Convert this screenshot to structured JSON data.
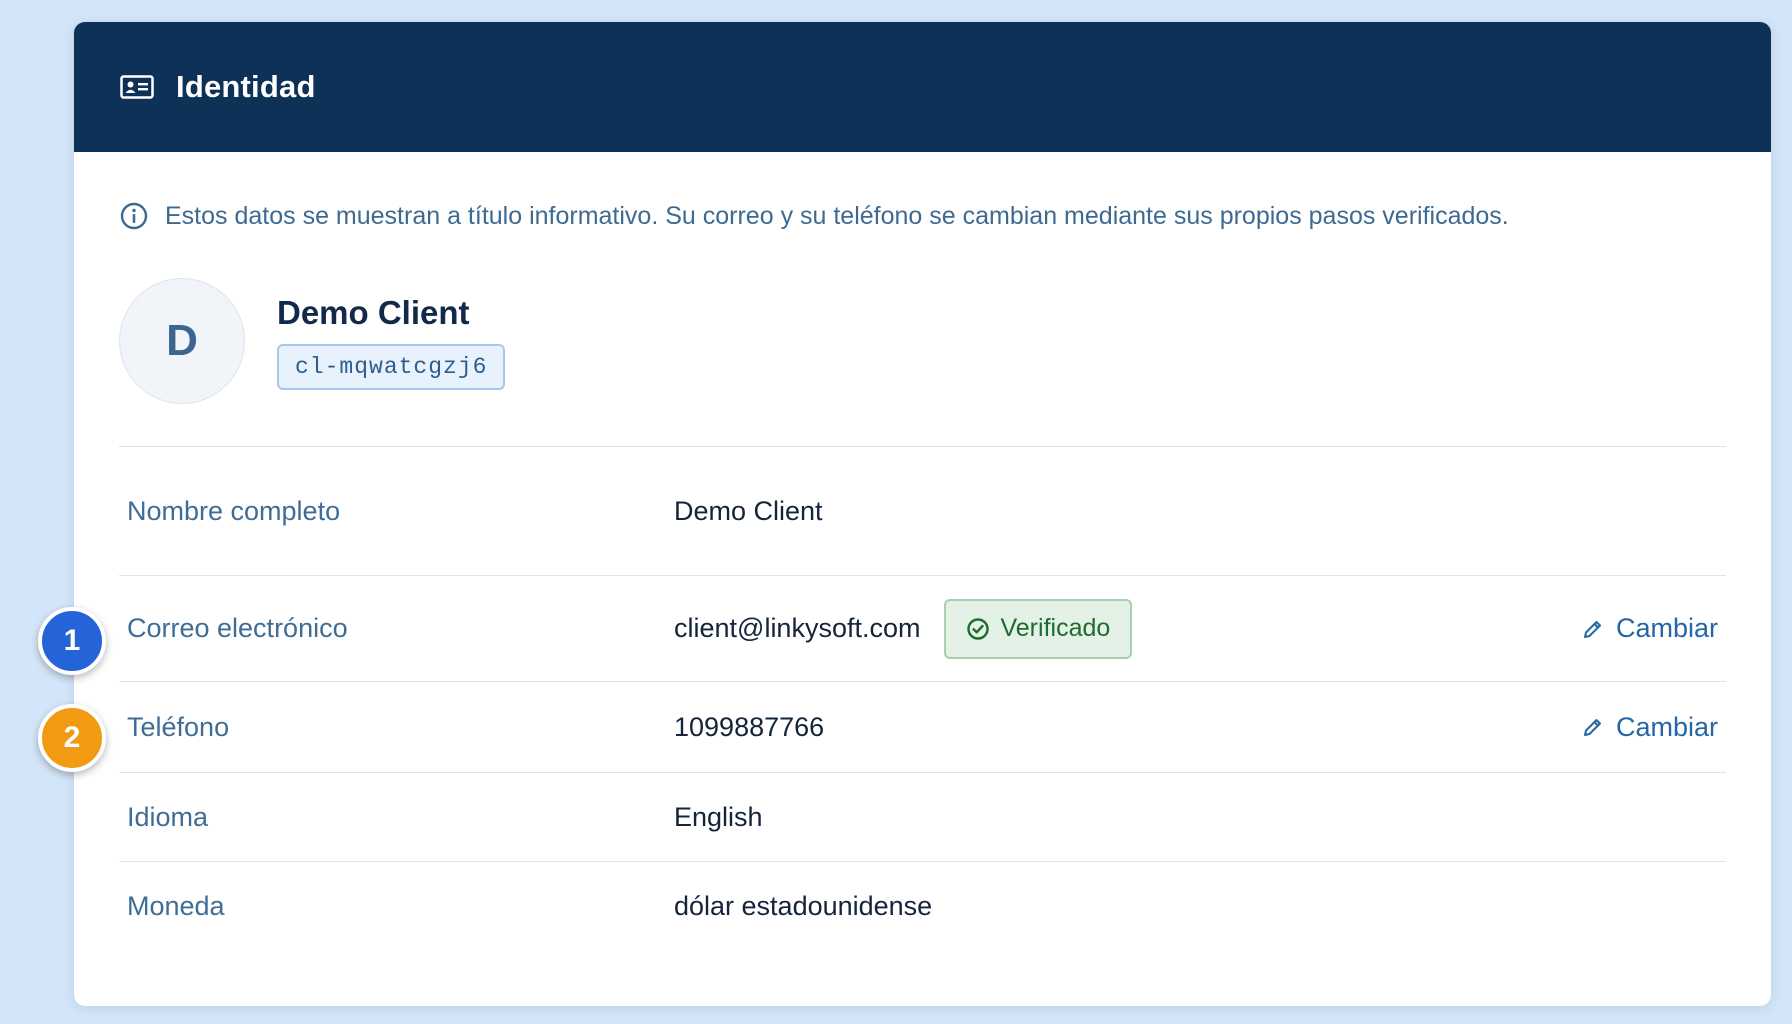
{
  "header": {
    "title": "Identidad",
    "icon": "id-card-icon"
  },
  "info": {
    "icon": "info-circle-icon",
    "text": "Estos datos se muestran a título informativo. Su correo y su teléfono se cambian mediante sus propios pasos verificados."
  },
  "profile": {
    "avatar_initial": "D",
    "name": "Demo Client",
    "client_id": "cl-mqwatcgzj6"
  },
  "rows": [
    {
      "label": "Nombre completo",
      "value": "Demo Client"
    },
    {
      "label": "Correo electrónico",
      "value": "client@linkysoft.com",
      "badge": "Verificado",
      "action": "Cambiar"
    },
    {
      "label": "Teléfono",
      "value": "1099887766",
      "action": "Cambiar"
    },
    {
      "label": "Idioma",
      "value": "English"
    },
    {
      "label": "Moneda",
      "value": "dólar estadounidense"
    }
  ],
  "markers": [
    {
      "number": "1",
      "color": "#2563d9"
    },
    {
      "number": "2",
      "color": "#f29a12"
    }
  ],
  "colors": {
    "header_bg": "#0e3158",
    "page_bg": "#d3e5f8",
    "link": "#2566a6",
    "verified": "#1e6b2e"
  }
}
